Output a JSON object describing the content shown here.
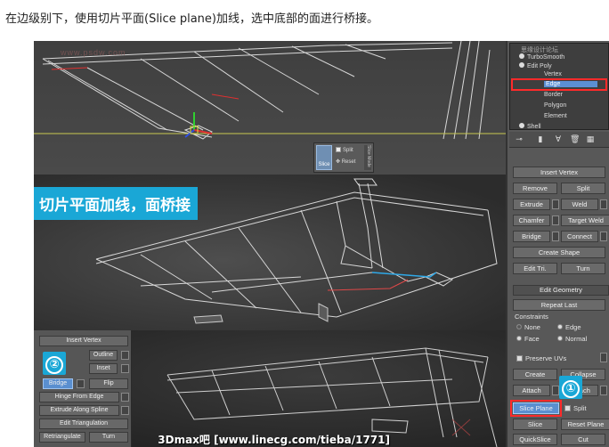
{
  "caption": "在边级别下，使用切片平面(Slice plane)加线，选中底部的面进行桥接。",
  "viewport_top": {
    "watermark": "www.psdw.com",
    "slice_toolbar": {
      "slice_label": "Slice",
      "split_label": "Split",
      "reset_label": "Reset",
      "mode_label": "Slice Mode"
    }
  },
  "viewport_middle": {
    "banner": "切片平面加线，面桥接"
  },
  "viewport_bottom": {
    "mini_panel": {
      "insert_vertex": "Insert Vertex",
      "outline": "Outline",
      "inset": "Inset",
      "bridge": "Bridge",
      "flip": "Flip",
      "hinge_from_edge": "Hinge From Edge",
      "extrude_along_spline": "Extrude Along Spline",
      "edit_triangulation": "Edit Triangulation",
      "retriangulate": "Retriangulate",
      "turn": "Turn"
    },
    "badge_2": "②",
    "footer_watermark": "3Dmax吧 [www.linecg.com/tieba/1771]"
  },
  "command_panel": {
    "stack_header": "思缘设计论坛",
    "modifier_stack": [
      {
        "label": "TurboSmooth"
      },
      {
        "label": "Edit Poly"
      },
      {
        "label": "Vertex"
      },
      {
        "label": "Edge"
      },
      {
        "label": "Border"
      },
      {
        "label": "Polygon"
      },
      {
        "label": "Element"
      },
      {
        "label": "Shell"
      }
    ],
    "edit_edges": {
      "insert_vertex": "Insert Vertex",
      "remove": "Remove",
      "split": "Split",
      "extrude": "Extrude",
      "weld": "Weld",
      "chamfer": "Chamfer",
      "target_weld": "Target Weld",
      "bridge": "Bridge",
      "connect": "Connect",
      "create_shape": "Create Shape",
      "edit_tri": "Edit Tri.",
      "turn": "Turn"
    },
    "edit_geometry": {
      "title": "Edit Geometry",
      "repeat_last": "Repeat Last",
      "constraints_label": "Constraints",
      "none": "None",
      "edge": "Edge",
      "face": "Face",
      "normal": "Normal",
      "constraint_selected": "None",
      "preserve_uvs": "Preserve UVs",
      "create": "Create",
      "collapse": "Collapse",
      "attach": "Attach",
      "detach": "Detach",
      "slice_plane": "Slice Plane",
      "split": "Split",
      "slice": "Slice",
      "reset_plane": "Reset Plane",
      "quickslice": "QuickSlice",
      "cut": "Cut"
    },
    "badge_1": "①"
  },
  "colors": {
    "accent_blue": "#1aa7d6",
    "selection_blue": "#5a8fd0",
    "highlight_red": "#ff2a2a"
  }
}
